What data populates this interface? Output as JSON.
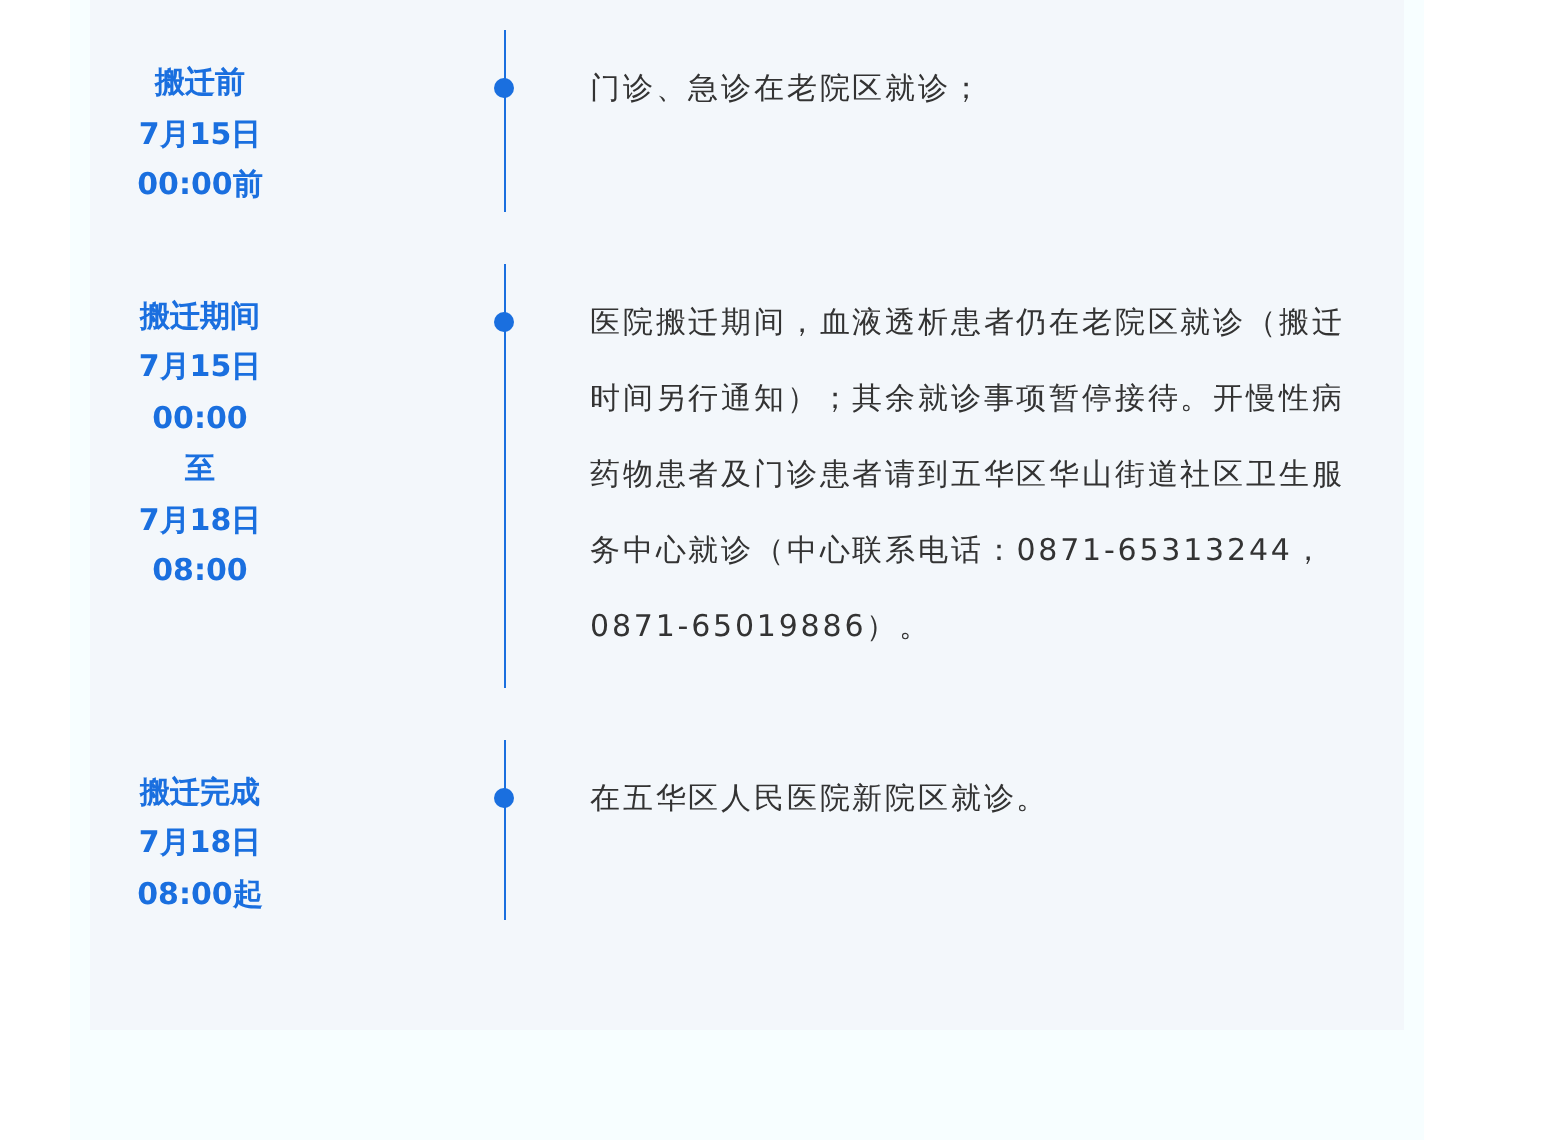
{
  "timeline": [
    {
      "period": [
        "搬迁前",
        "7月15日",
        "00:00前"
      ],
      "description": "门诊、急诊在老院区就诊；"
    },
    {
      "period": [
        "搬迁期间",
        "7月15日",
        "00:00",
        "至",
        "7月18日",
        "08:00"
      ],
      "description": "医院搬迁期间，血液透析患者仍在老院区就诊（搬迁时间另行通知）；其余就诊事项暂停接待。开慢性病药物患者及门诊患者请到五华区华山街道社区卫生服务中心就诊（中心联系电话：0871-65313244，0871-65019886）。"
    },
    {
      "period": [
        "搬迁完成",
        "7月18日",
        "08:00起"
      ],
      "description": "在五华区人民医院新院区就诊。"
    }
  ]
}
